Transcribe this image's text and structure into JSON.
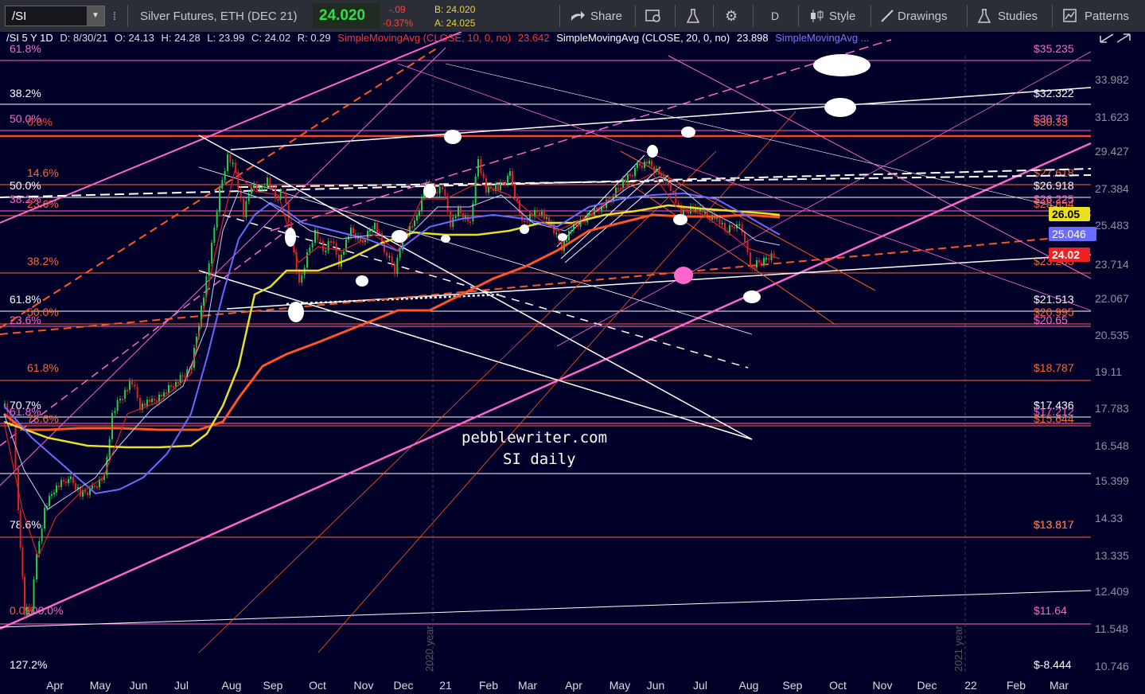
{
  "toolbar": {
    "symbol": "/SI",
    "symbol_dropdown": "▼",
    "description": "Silver Futures, ETH (DEC 21)",
    "last": "24.020",
    "change": "-.09",
    "change_pct": "-0.37%",
    "bid": "B: 24.020",
    "ask": "A: 24.025",
    "share": "Share",
    "period": "D",
    "style": "Style",
    "drawings": "Drawings",
    "studies": "Studies",
    "patterns": "Patterns"
  },
  "statusbar": {
    "title": "/SI 5 Y 1D",
    "date": "D: 8/30/21",
    "open": "O: 24.13",
    "high": "H: 24.28",
    "low": "L: 23.99",
    "close": "C: 24.02",
    "range": "R: 0.29",
    "sma10_label": "SimpleMovingAvg (CLOSE, 10, 0, no)",
    "sma10_value": "23.642",
    "sma20_label": "SimpleMovingAvg (CLOSE, 20, 0, no)",
    "sma20_value": "23.898",
    "sma_more": "SimpleMovingAvg ..."
  },
  "watermark": {
    "line1": "pebblewriter.com",
    "line2": "SI daily"
  },
  "axis": {
    "price_ticks": [
      "33.982",
      "31.623",
      "29.427",
      "27.384",
      "25.483",
      "23.714",
      "22.067",
      "20.535",
      "19.11",
      "17.783",
      "16.548",
      "15.399",
      "14.33",
      "13.335",
      "12.409",
      "11.548",
      "10.746"
    ],
    "months": [
      "Apr",
      "May",
      "Jun",
      "Jul",
      "Aug",
      "Sep",
      "Oct",
      "Nov",
      "Dec",
      "21",
      "Feb",
      "Mar",
      "Apr",
      "May",
      "Jun",
      "Jul",
      "Aug",
      "Sep",
      "Oct",
      "Nov",
      "Dec",
      "22",
      "Feb",
      "Mar"
    ],
    "year_markers": [
      "2020 year",
      "2021 year"
    ],
    "badge_yellow": "26.05",
    "badge_blue": "25.046",
    "badge_red": "24.02"
  },
  "levels": {
    "left": [
      {
        "t": "61.8%",
        "c": "#ff66cc"
      },
      {
        "t": "38.2%",
        "c": "#ffffff"
      },
      {
        "t": "50.0%",
        "c": "#ff66cc"
      },
      {
        "t": "0.0%",
        "c": "#ff4422"
      },
      {
        "t": "14.6%",
        "c": "#ff6633"
      },
      {
        "t": "50.0%",
        "c": "#ffffff"
      },
      {
        "t": "38.2%",
        "c": "#ff66cc"
      },
      {
        "t": "23.6%",
        "c": "#ff6633"
      },
      {
        "t": "38.2%",
        "c": "#ff6633"
      },
      {
        "t": "61.8%",
        "c": "#ffffff"
      },
      {
        "t": "50.0%",
        "c": "#ff6633"
      },
      {
        "t": "23.6%",
        "c": "#ff66cc"
      },
      {
        "t": "61.8%",
        "c": "#ff6633"
      },
      {
        "t": "70.7%",
        "c": "#ffffff"
      },
      {
        "t": "61.8%",
        "c": "#ff66cc"
      },
      {
        "t": "78.6%",
        "c": "#ff6633"
      },
      {
        "t": "78.6%",
        "c": "#ffffff"
      },
      {
        "t": "0.0%",
        "c": "#ff6633"
      },
      {
        "t": "100.0%",
        "c": "#ff66cc"
      },
      {
        "t": "127.2%",
        "c": "#ffffff"
      }
    ],
    "right": [
      {
        "t": "$35.235",
        "c": "#ff66cc"
      },
      {
        "t": "$32.322",
        "c": "#ffffff"
      },
      {
        "t": "$30.73",
        "c": "#ff66cc"
      },
      {
        "t": "$30.33",
        "c": "#ff6633"
      },
      {
        "t": "$27.618",
        "c": "#ff6633"
      },
      {
        "t": "$26.918",
        "c": "#ffffff"
      },
      {
        "t": "$26.225",
        "c": "#ff66cc"
      },
      {
        "t": "$25.854",
        "c": "#ff6633"
      },
      {
        "t": "$23.203",
        "c": "#ff6633"
      },
      {
        "t": "$21.513",
        "c": "#ffffff"
      },
      {
        "t": "$20.995",
        "c": "#ff6633"
      },
      {
        "t": "$20.65",
        "c": "#ff66cc"
      },
      {
        "t": "$18.787",
        "c": "#ff6633"
      },
      {
        "t": "$17.436",
        "c": "#ffffff"
      },
      {
        "t": "$17.212",
        "c": "#ff66cc"
      },
      {
        "t": "$15.644",
        "c": "#ff6633"
      },
      {
        "t": "$13.817",
        "c": "#ffffff"
      },
      {
        "t": "$13.817",
        "c": "#ff6633"
      },
      {
        "t": "$11.64",
        "c": "#ff66cc"
      },
      {
        "t": "$-8.444",
        "c": "#ffffff"
      }
    ]
  },
  "colors": {
    "background": "#000028",
    "pink": "#ff66cc",
    "orange": "#ff5522",
    "white": "#ffffff",
    "yellow": "#e8e020",
    "blue": "#6a6aff",
    "up": "#22cc44",
    "down": "#dd2222"
  }
}
